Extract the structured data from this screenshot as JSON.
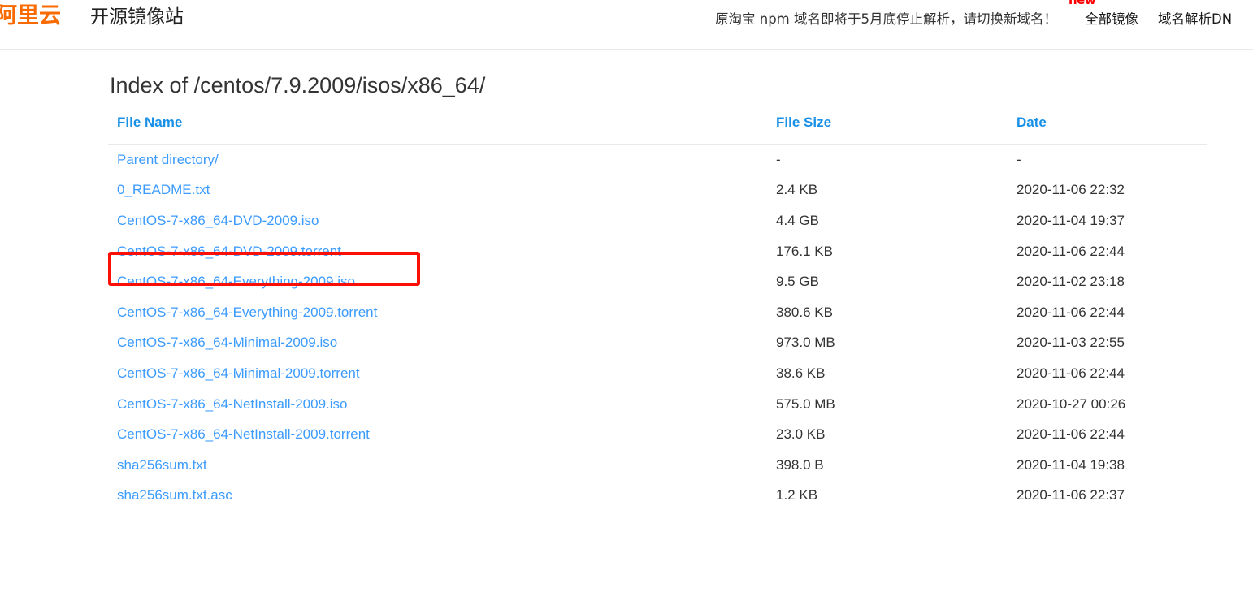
{
  "header": {
    "logo_text": "阿里云",
    "site_title": "开源镜像站",
    "notice": "原淘宝 npm 域名即将于5月底停止解析，请切换新域名！",
    "new_badge": "new",
    "nav": [
      {
        "label": "全部镜像"
      },
      {
        "label": "域名解析DN"
      }
    ]
  },
  "page": {
    "index_title": "Index of /centos/7.9.2009/isos/x86_64/"
  },
  "table": {
    "columns": {
      "name": "File Name",
      "size": "File Size",
      "date": "Date"
    },
    "rows": [
      {
        "name": "Parent directory/",
        "size": "-",
        "date": "-"
      },
      {
        "name": "0_README.txt",
        "size": "2.4 KB",
        "date": "2020-11-06 22:32"
      },
      {
        "name": "CentOS-7-x86_64-DVD-2009.iso",
        "size": "4.4 GB",
        "date": "2020-11-04 19:37"
      },
      {
        "name": "CentOS-7-x86_64-DVD-2009.torrent",
        "size": "176.1 KB",
        "date": "2020-11-06 22:44"
      },
      {
        "name": "CentOS-7-x86_64-Everything-2009.iso",
        "size": "9.5 GB",
        "date": "2020-11-02 23:18"
      },
      {
        "name": "CentOS-7-x86_64-Everything-2009.torrent",
        "size": "380.6 KB",
        "date": "2020-11-06 22:44"
      },
      {
        "name": "CentOS-7-x86_64-Minimal-2009.iso",
        "size": "973.0 MB",
        "date": "2020-11-03 22:55"
      },
      {
        "name": "CentOS-7-x86_64-Minimal-2009.torrent",
        "size": "38.6 KB",
        "date": "2020-11-06 22:44"
      },
      {
        "name": "CentOS-7-x86_64-NetInstall-2009.iso",
        "size": "575.0 MB",
        "date": "2020-10-27 00:26"
      },
      {
        "name": "CentOS-7-x86_64-NetInstall-2009.torrent",
        "size": "23.0 KB",
        "date": "2020-11-06 22:44"
      },
      {
        "name": "sha256sum.txt",
        "size": "398.0 B",
        "date": "2020-11-04 19:38"
      },
      {
        "name": "sha256sum.txt.asc",
        "size": "1.2 KB",
        "date": "2020-11-06 22:37"
      }
    ],
    "highlighted_row_index": 2
  },
  "colors": {
    "brand_orange": "#f96a00",
    "header_blue": "#1890e8",
    "link_blue": "#3b9bff",
    "annotation_red": "#fc1005"
  }
}
